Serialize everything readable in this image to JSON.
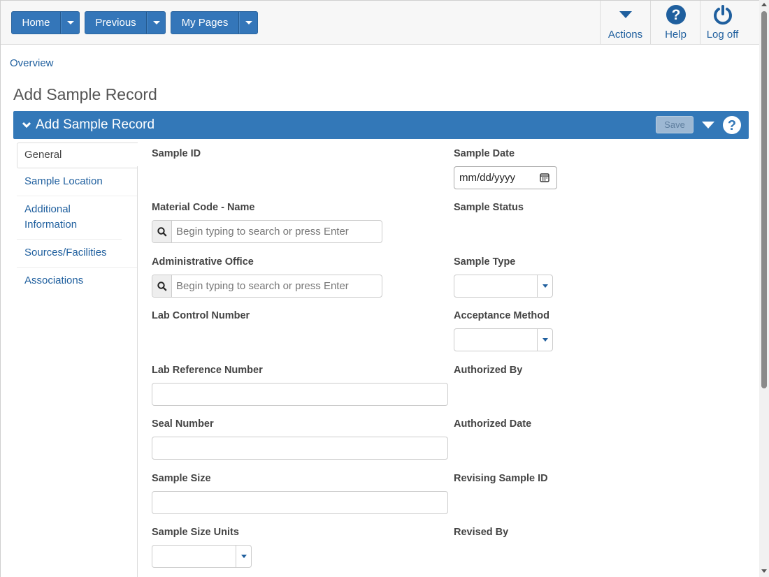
{
  "topbar": {
    "nav_buttons": [
      {
        "label": "Home"
      },
      {
        "label": "Previous"
      },
      {
        "label": "My Pages"
      }
    ],
    "actions_label": "Actions",
    "help_label": "Help",
    "logoff_label": "Log off"
  },
  "breadcrumb": {
    "overview": "Overview"
  },
  "page_title": "Add Sample Record",
  "panel": {
    "title": "Add Sample Record",
    "save_label": "Save"
  },
  "sidenav": {
    "items": [
      {
        "label": "General"
      },
      {
        "label": "Sample Location"
      },
      {
        "label": "Additional Information"
      },
      {
        "label": "Sources/Facilities"
      },
      {
        "label": "Associations"
      }
    ]
  },
  "form": {
    "sample_id": {
      "label": "Sample ID"
    },
    "sample_date": {
      "label": "Sample Date",
      "value": "mm/dd/yyyy"
    },
    "material_code": {
      "label": "Material Code - Name",
      "placeholder": "Begin typing to search or press Enter"
    },
    "sample_status": {
      "label": "Sample Status"
    },
    "admin_office": {
      "label": "Administrative Office",
      "placeholder": "Begin typing to search or press Enter"
    },
    "sample_type": {
      "label": "Sample Type",
      "value": ""
    },
    "lab_control_number": {
      "label": "Lab Control Number"
    },
    "acceptance_method": {
      "label": "Acceptance Method",
      "value": ""
    },
    "lab_reference_number": {
      "label": "Lab Reference Number",
      "value": ""
    },
    "authorized_by": {
      "label": "Authorized By"
    },
    "seal_number": {
      "label": "Seal Number",
      "value": ""
    },
    "authorized_date": {
      "label": "Authorized Date"
    },
    "sample_size": {
      "label": "Sample Size",
      "value": ""
    },
    "revising_sample_id": {
      "label": "Revising Sample ID"
    },
    "sample_size_units": {
      "label": "Sample Size Units",
      "value": ""
    },
    "revised_by": {
      "label": "Revised By"
    }
  },
  "colors": {
    "primary": "#3378b8",
    "link": "#1f5f9e",
    "save_disabled": "#9db8d3"
  },
  "icons": [
    "chevron-down-icon",
    "question-circle-icon",
    "power-icon",
    "search-icon",
    "calendar-icon"
  ]
}
